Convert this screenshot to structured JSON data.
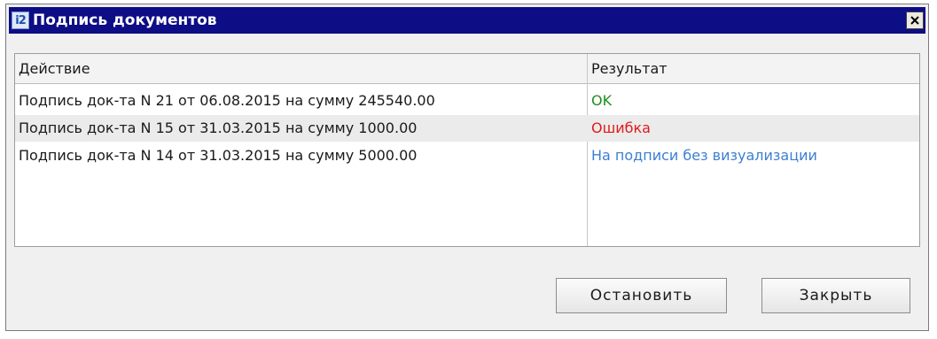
{
  "window": {
    "title": "Подпись документов",
    "app_icon_text": "i2"
  },
  "table": {
    "columns": [
      "Действие",
      "Результат"
    ],
    "rows": [
      {
        "action": "Подпись док-та N 21 от 06.08.2015 на сумму 245540.00",
        "result": "OK",
        "result_color": "#1e8f1e"
      },
      {
        "action": "Подпись док-та N 15 от 31.03.2015 на сумму 1000.00",
        "result": "Ошибка",
        "result_color": "#e01b1b"
      },
      {
        "action": "Подпись док-та N 14 от 31.03.2015 на сумму 5000.00",
        "result": "На подписи без визуализации",
        "result_color": "#3c7fd1"
      }
    ]
  },
  "buttons": {
    "stop_label": "Остановить",
    "close_label": "Закрыть"
  }
}
